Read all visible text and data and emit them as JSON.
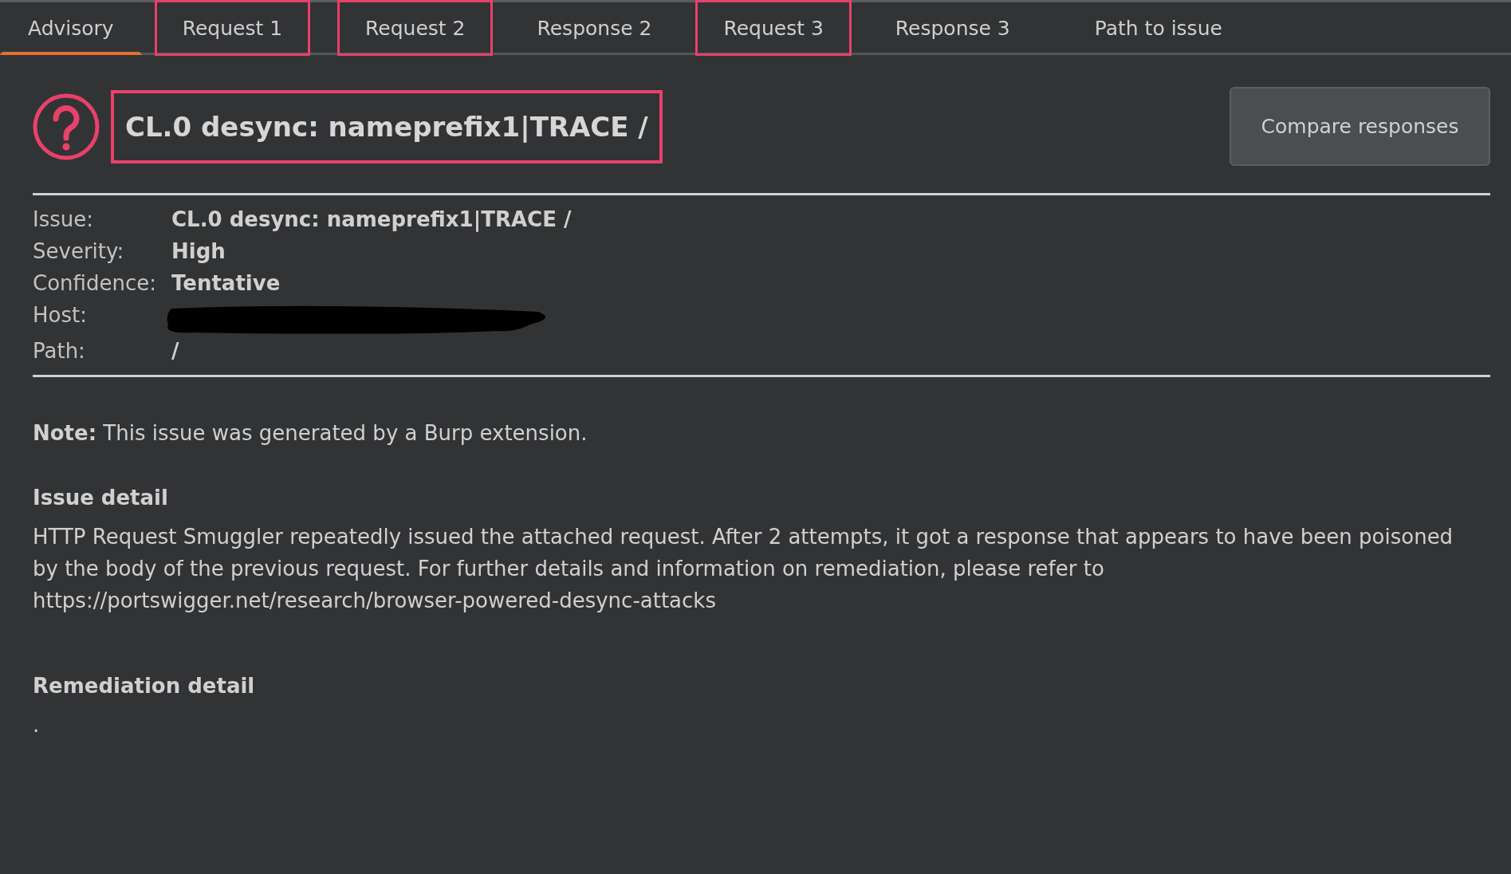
{
  "tabs": [
    {
      "label": "Advisory",
      "selected": true,
      "highlighted": false
    },
    {
      "label": "Request 1",
      "selected": false,
      "highlighted": true
    },
    {
      "label": "Request 2",
      "selected": false,
      "highlighted": true
    },
    {
      "label": "Response 2",
      "selected": false,
      "highlighted": false
    },
    {
      "label": "Request 3",
      "selected": false,
      "highlighted": true
    },
    {
      "label": "Response 3",
      "selected": false,
      "highlighted": false
    },
    {
      "label": "Path to issue",
      "selected": false,
      "highlighted": false
    }
  ],
  "header": {
    "title": "CL.0 desync: nameprefix1|TRACE /",
    "title_highlighted": true,
    "button": "Compare responses"
  },
  "details": [
    {
      "label": "Issue:",
      "value": "CL.0 desync: nameprefix1|TRACE /",
      "redacted": false
    },
    {
      "label": "Severity:",
      "value": "High",
      "redacted": false
    },
    {
      "label": "Confidence:",
      "value": "Tentative",
      "redacted": false
    },
    {
      "label": "Host:",
      "redacted": true
    },
    {
      "label": "Path:",
      "value": "/",
      "redacted": false
    }
  ],
  "note": "**Note:** This issue was generated by a Burp extension.",
  "sections": [
    {
      "heading": "Issue detail",
      "text": "HTTP Request Smuggler repeatedly issued the attached request. After 2 attempts, it got a response that appears to have been poisoned by the body of the previous request. For further details and information on remediation, please refer to https://portswigger.net/research/browser-powered-desync-attacks"
    },
    {
      "heading": "Remediation detail",
      "text": "."
    }
  ]
}
